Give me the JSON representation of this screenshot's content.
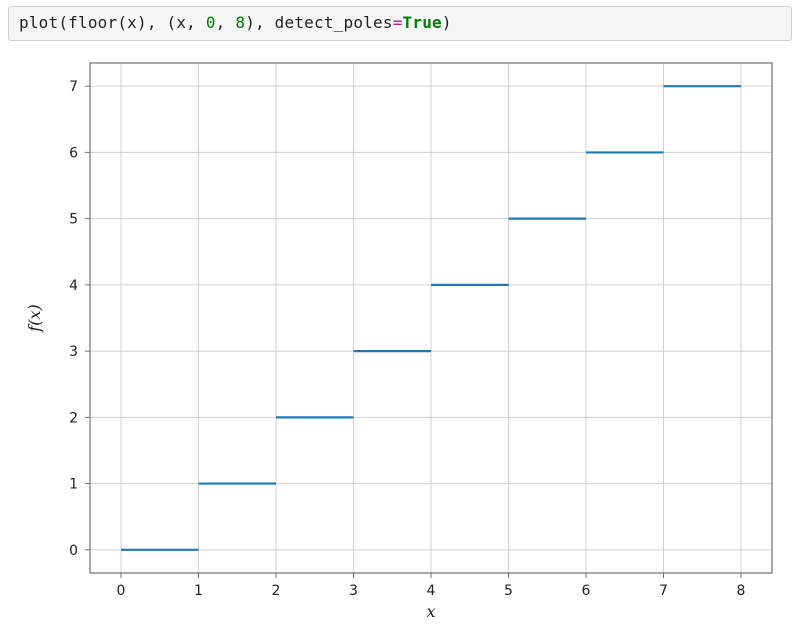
{
  "code_cell": {
    "tokens": [
      {
        "t": "plain",
        "v": "plot(floor(x), (x, "
      },
      {
        "t": "num",
        "v": "0"
      },
      {
        "t": "plain",
        "v": ", "
      },
      {
        "t": "num",
        "v": "8"
      },
      {
        "t": "plain",
        "v": "), detect_poles"
      },
      {
        "t": "op",
        "v": "="
      },
      {
        "t": "kw",
        "v": "True"
      },
      {
        "t": "plain",
        "v": ")"
      }
    ]
  },
  "chart_data": {
    "type": "line",
    "title": "",
    "xlabel": "x",
    "ylabel": "f(x)",
    "xlim": [
      -0.4,
      8.4
    ],
    "ylim": [
      -0.35,
      7.35
    ],
    "x_ticks": [
      0,
      1,
      2,
      3,
      4,
      5,
      6,
      7,
      8
    ],
    "y_ticks": [
      0,
      1,
      2,
      3,
      4,
      5,
      6,
      7
    ],
    "x_tick_labels": [
      "0",
      "1",
      "2",
      "3",
      "4",
      "5",
      "6",
      "7",
      "8"
    ],
    "y_tick_labels": [
      "0",
      "1",
      "2",
      "3",
      "4",
      "5",
      "6",
      "7"
    ],
    "grid": true,
    "legend": null,
    "colors": {
      "series_1": "#1f77b4"
    },
    "series": [
      {
        "name": "floor(x)",
        "segments": [
          {
            "x0": 0,
            "x1": 1,
            "y": 0
          },
          {
            "x0": 1,
            "x1": 2,
            "y": 1
          },
          {
            "x0": 2,
            "x1": 3,
            "y": 2
          },
          {
            "x0": 3,
            "x1": 4,
            "y": 3
          },
          {
            "x0": 4,
            "x1": 5,
            "y": 4
          },
          {
            "x0": 5,
            "x1": 6,
            "y": 5
          },
          {
            "x0": 6,
            "x1": 7,
            "y": 6
          },
          {
            "x0": 7,
            "x1": 8,
            "y": 7
          }
        ]
      }
    ]
  }
}
